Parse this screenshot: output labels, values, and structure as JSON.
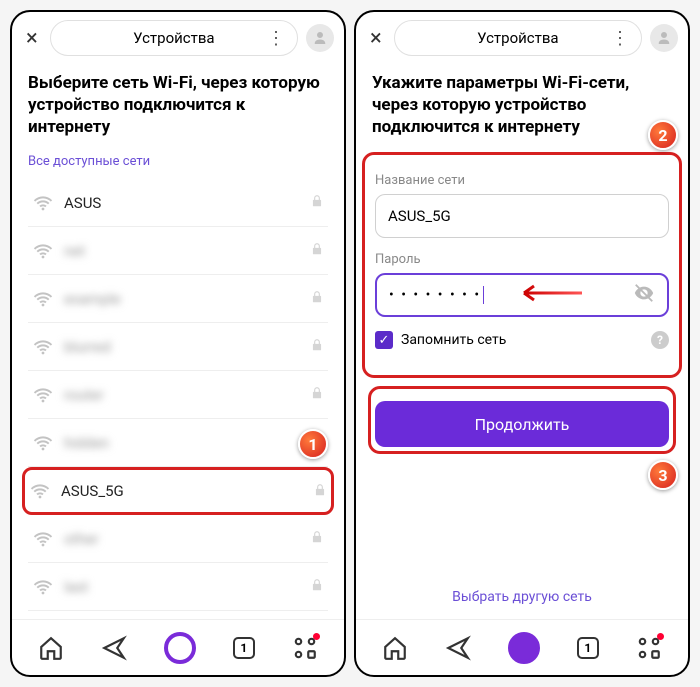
{
  "header": {
    "title": "Устройства",
    "close": "×",
    "menu": "⋮"
  },
  "left": {
    "heading": "Выберите сеть Wi-Fi, через которую устройство подключится к интернету",
    "allNetworks": "Все доступные сети",
    "networks": [
      {
        "name": "ASUS",
        "blur": false
      },
      {
        "name": "net",
        "blur": true
      },
      {
        "name": "example",
        "blur": true
      },
      {
        "name": "blurred",
        "blur": true
      },
      {
        "name": "router",
        "blur": true
      },
      {
        "name": "hidden",
        "blur": true
      },
      {
        "name": "ASUS_5G",
        "blur": false,
        "highlighted": true
      },
      {
        "name": "other",
        "blur": true
      },
      {
        "name": "last",
        "blur": true
      }
    ]
  },
  "right": {
    "heading": "Укажите параметры Wi-Fi-сети, через которую устройство подключится к интернету",
    "ssidLabel": "Название сети",
    "ssidValue": "ASUS_5G",
    "passLabel": "Пароль",
    "passMasked": "• • • • • • • •",
    "remember": "Запомнить сеть",
    "continueBtn": "Продолжить",
    "chooseOther": "Выбрать другую сеть"
  },
  "badges": {
    "b1": "1",
    "b2": "2",
    "b3": "3"
  },
  "nav": {
    "tabcount": "1"
  }
}
